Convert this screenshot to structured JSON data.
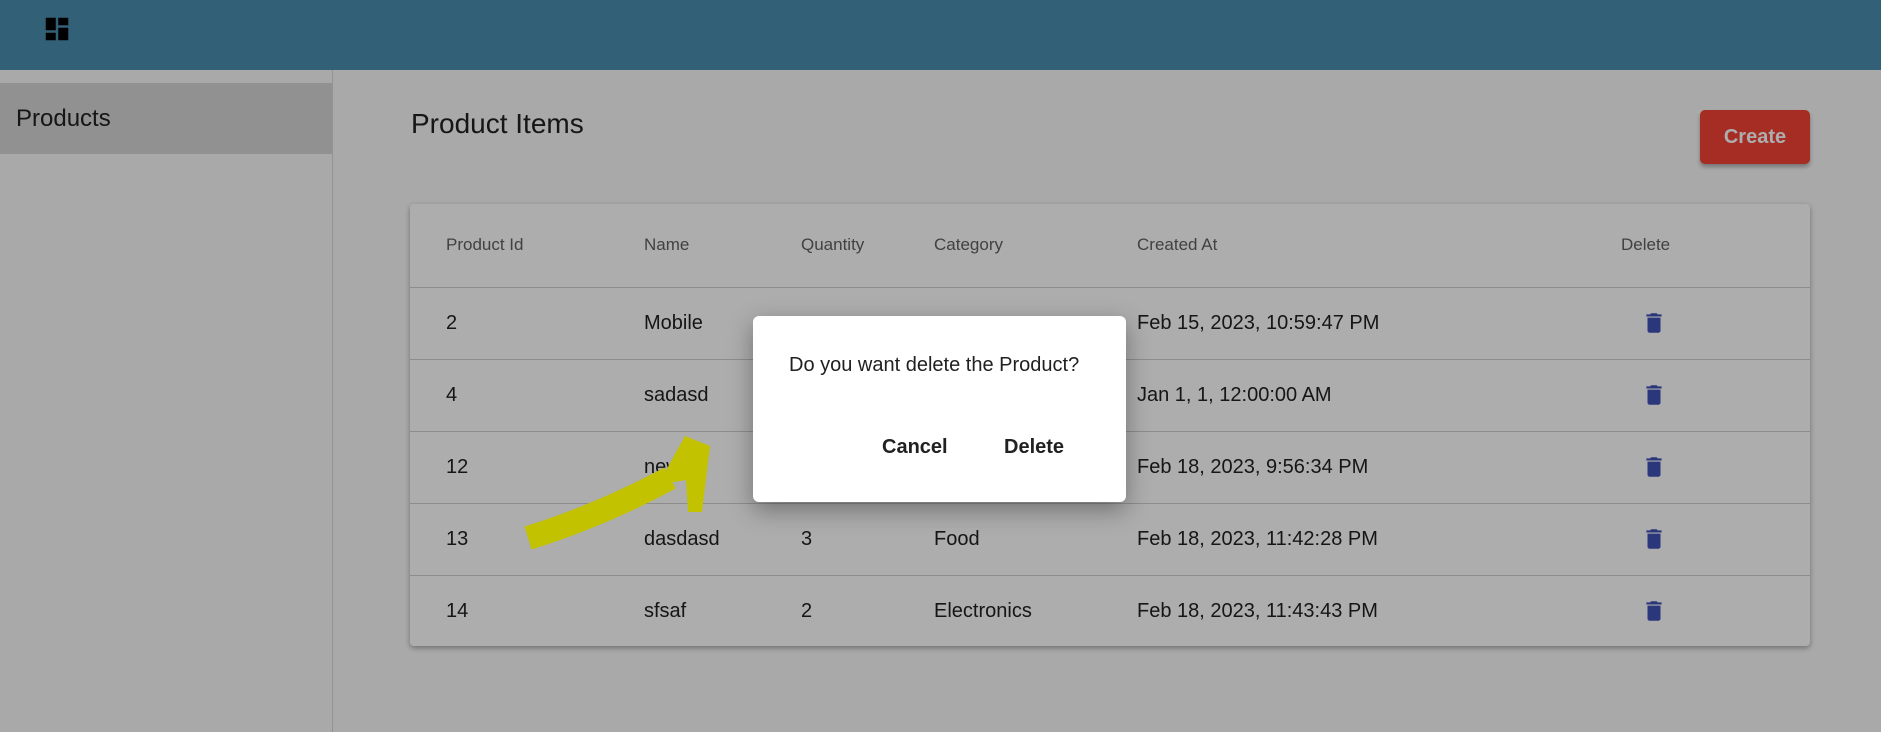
{
  "colors": {
    "header_bg": "#4a8fb0",
    "create_button": "#f44336",
    "trash_icon": "#3f51b5",
    "annotation_arrow": "#f5f500"
  },
  "header": {
    "menu_icon": "dashboard-icon"
  },
  "sidebar": {
    "items": [
      {
        "label": "Products",
        "selected": true
      }
    ]
  },
  "main": {
    "title": "Product Items",
    "create_label": "Create",
    "table": {
      "headers": {
        "id": "Product Id",
        "name": "Name",
        "quantity": "Quantity",
        "category": "Category",
        "created": "Created At",
        "delete": "Delete"
      },
      "rows": [
        {
          "id": "2",
          "name": "Mobile",
          "quantity": "",
          "category": "",
          "created": "Feb 15, 2023, 10:59:47 PM"
        },
        {
          "id": "4",
          "name": "sadasd",
          "quantity": "",
          "category": "",
          "created": "Jan 1, 1, 12:00:00 AM"
        },
        {
          "id": "12",
          "name": "new",
          "quantity": "",
          "category": "",
          "created": "Feb 18, 2023, 9:56:34 PM"
        },
        {
          "id": "13",
          "name": "dasdasd",
          "quantity": "3",
          "category": "Food",
          "created": "Feb 18, 2023, 11:42:28 PM"
        },
        {
          "id": "14",
          "name": "sfsaf",
          "quantity": "2",
          "category": "Electronics",
          "created": "Feb 18, 2023, 11:43:43 PM"
        }
      ],
      "row_action_icon": "trash-icon"
    }
  },
  "dialog": {
    "message": "Do you want delete the Product?",
    "cancel_label": "Cancel",
    "delete_label": "Delete"
  }
}
